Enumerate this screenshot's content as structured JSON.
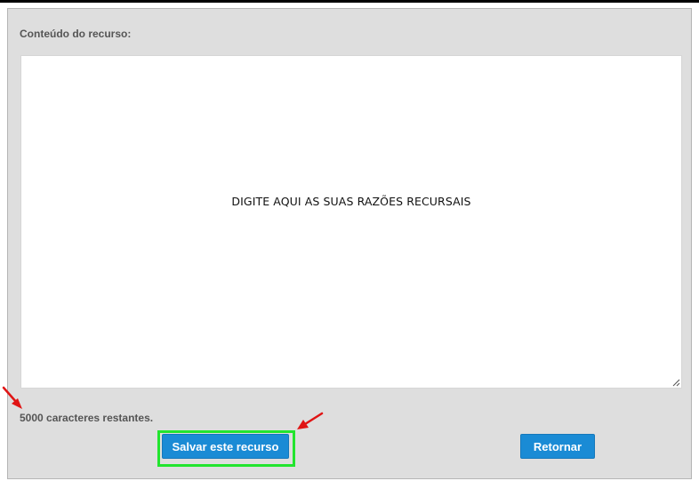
{
  "form": {
    "content_label": "Conteúdo do recurso:",
    "textarea_text": "DIGITE AQUI AS SUAS RAZÕES RECURSAIS",
    "counter_text": "5000 caracteres restantes.",
    "save_button_label": "Salvar este recurso",
    "return_button_label": "Retornar"
  },
  "colors": {
    "panel_background": "#dedede",
    "button_primary": "#1a8bd5",
    "highlight_box": "#22e52e",
    "annotation_arrow": "#e01414"
  },
  "annotations": {
    "arrows": [
      "counter-arrow",
      "save-button-arrow"
    ],
    "highlight": "save-button-highlight"
  }
}
